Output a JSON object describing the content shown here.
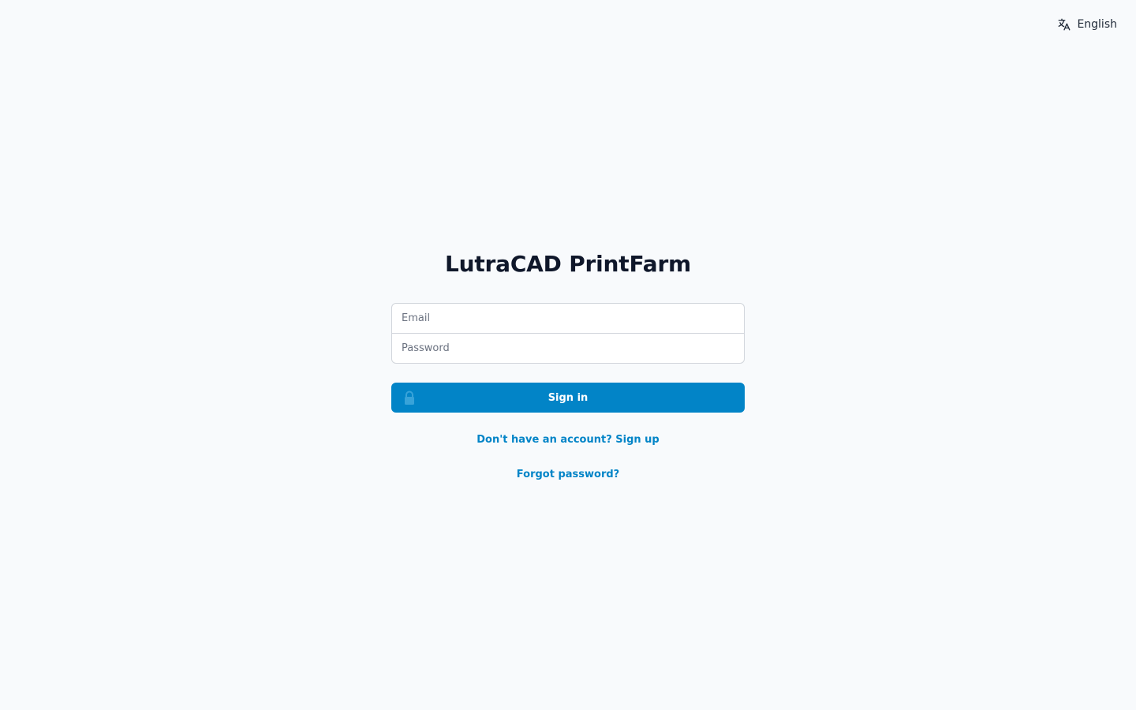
{
  "language": {
    "icon": "translate-icon",
    "label": "English"
  },
  "app": {
    "title": "LutraCAD PrintFarm"
  },
  "form": {
    "email_placeholder": "Email",
    "password_placeholder": "Password",
    "email_value": "",
    "password_value": "",
    "submit_label": "Sign in",
    "submit_icon": "lock-icon"
  },
  "links": {
    "signup": "Don't have an account? Sign up",
    "forgot": "Forgot password?"
  },
  "colors": {
    "background": "#f8fafc",
    "primary": "#0284c7",
    "title": "#0f172a"
  }
}
